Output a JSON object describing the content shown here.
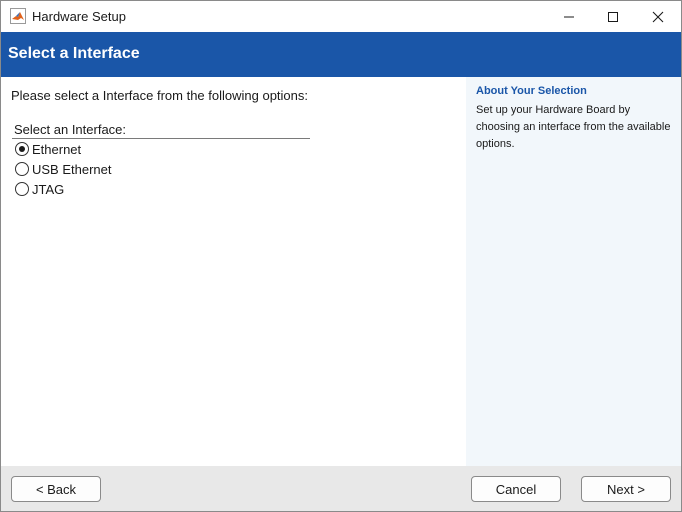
{
  "window": {
    "title": "Hardware Setup"
  },
  "banner": {
    "title": "Select a Interface"
  },
  "main": {
    "prompt": "Please select a Interface from the following options:",
    "group_label": "Select an Interface:",
    "options": [
      {
        "label": "Ethernet",
        "selected": true
      },
      {
        "label": "USB Ethernet",
        "selected": false
      },
      {
        "label": "JTAG",
        "selected": false
      }
    ]
  },
  "info": {
    "title": "About Your Selection",
    "body": "Set up your Hardware Board by choosing an interface from the available options."
  },
  "footer": {
    "back_label": "< Back",
    "cancel_label": "Cancel",
    "next_label": "Next >"
  },
  "colors": {
    "accent": "#1a56a8",
    "info_bg": "#f2f7fb",
    "footer_bg": "#e8e8e8"
  },
  "icons": {
    "app": "matlab-logo-icon",
    "minimize": "minimize-icon",
    "maximize": "maximize-icon",
    "close": "close-icon"
  }
}
